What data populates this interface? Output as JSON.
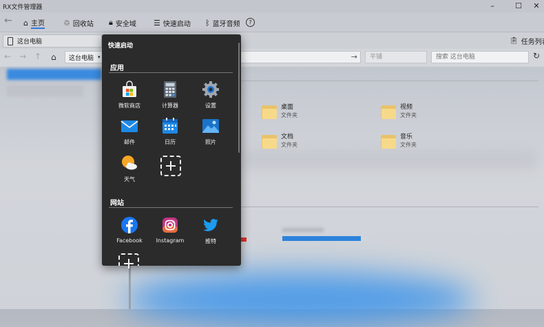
{
  "app": {
    "title": "RX文件管理器"
  },
  "window": {
    "min": "–",
    "max": "☐",
    "close": "✕"
  },
  "topnav": {
    "items": [
      {
        "label": "主页",
        "icon": "home-icon",
        "active": true
      },
      {
        "label": "回收站",
        "icon": "recycle-bin-icon"
      },
      {
        "label": "安全域",
        "icon": "lock-icon"
      },
      {
        "label": "快速启动",
        "icon": "list-icon"
      },
      {
        "label": "蓝牙音频",
        "icon": "bluetooth-icon"
      }
    ]
  },
  "tabs": [
    {
      "label": "这台电脑"
    }
  ],
  "taskpane": {
    "label": "任务列表"
  },
  "address": {
    "path": "这台电脑",
    "view": "平铺",
    "search_placeholder": "搜索 这台电脑"
  },
  "folders": [
    {
      "name": "桌面",
      "type": "文件夹"
    },
    {
      "name": "视频",
      "type": "文件夹"
    },
    {
      "name": "文档",
      "type": "文件夹"
    },
    {
      "name": "音乐",
      "type": "文件夹"
    }
  ],
  "quick_launch": {
    "title": "快速启动",
    "apps_section": "应用",
    "apps": [
      {
        "label": "微软商店",
        "icon": "store-icon"
      },
      {
        "label": "计算器",
        "icon": "calculator-icon"
      },
      {
        "label": "设置",
        "icon": "settings-icon"
      },
      {
        "label": "邮件",
        "icon": "mail-icon"
      },
      {
        "label": "日历",
        "icon": "calendar-icon"
      },
      {
        "label": "照片",
        "icon": "photos-icon"
      },
      {
        "label": "天气",
        "icon": "weather-icon"
      }
    ],
    "sites_section": "网站",
    "sites": [
      {
        "label": "Facebook",
        "icon": "facebook-icon"
      },
      {
        "label": "Instagram",
        "icon": "instagram-icon"
      },
      {
        "label": "推特",
        "icon": "twitter-icon"
      }
    ]
  }
}
